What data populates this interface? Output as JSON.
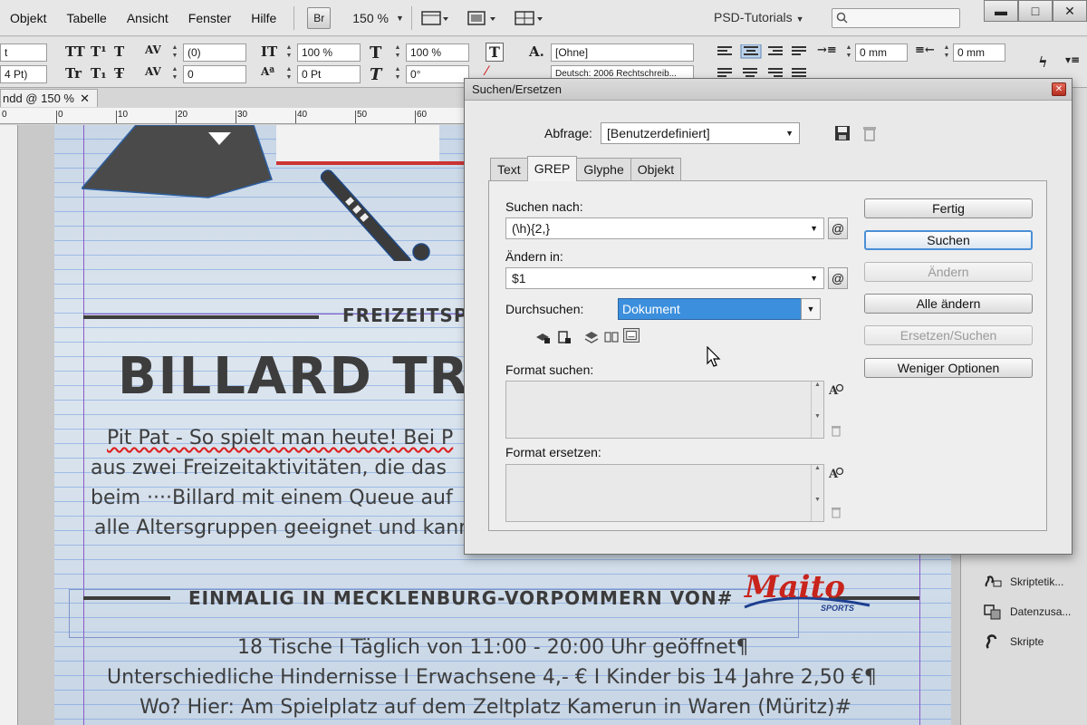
{
  "menubar": {
    "items": [
      "Objekt",
      "Tabelle",
      "Ansicht",
      "Fenster",
      "Hilfe"
    ],
    "bridge_label": "Br",
    "zoom": "150 %",
    "workspace": "PSD-Tutorials"
  },
  "controlpanel": {
    "font_size_a": "t",
    "font_size_b": "4 Pt)",
    "tracking": "(0)",
    "kerning": "0",
    "vert_scale": "100 %",
    "horiz_scale": "100 %",
    "baseline": "0 Pt",
    "skew": "0°",
    "char_style": "[Ohne]",
    "language": "Deutsch: 2006 Rechtschreib...",
    "indent_left": "0 mm",
    "indent_right": "0 mm"
  },
  "document": {
    "tab_label": "ndd @ 150 %",
    "ruler_ticks": [
      "0",
      "10",
      "20",
      "30",
      "40",
      "50",
      "60"
    ],
    "heading_sub": "FREIZEITSPA",
    "heading_main": "BILLARD TRIFF",
    "body_lines": [
      "Pit Pat - So spielt man heute! Bei P",
      "aus zwei Freizeitaktivitäten, die das",
      "beim ····Billard mit einem Queue auf",
      "alle Altersgruppen geeignet und kann"
    ],
    "region_heading": "EINMALIG IN MECKLENBURG-VORPOMMERN VON#",
    "logo_text": "Maito",
    "logo_sub": "SPORTS",
    "info_lines": [
      "18 Tische I Täglich  von 11:00  - 20:00 Uhr geöffnet¶",
      "Unterschiedliche Hindernisse I Erwachsene 4,- € I Kinder bis 14 Jahre 2,50 €¶",
      "Wo? Hier: Am Spielplatz auf dem Zeltplatz   Kamerun in Waren (Müritz)#"
    ]
  },
  "right_panel": {
    "items": [
      "Skriptetik...",
      "Datenzusa...",
      "Skripte"
    ]
  },
  "dialog": {
    "title": "Suchen/Ersetzen",
    "query_label": "Abfrage:",
    "query_value": "[Benutzerdefiniert]",
    "tabs": [
      "Text",
      "GREP",
      "Glyphe",
      "Objekt"
    ],
    "active_tab": "GREP",
    "search_label": "Suchen nach:",
    "search_value": "(\\h){2,}",
    "replace_label": "Ändern in:",
    "replace_value": "$1",
    "scope_label": "Durchsuchen:",
    "scope_value": "Dokument",
    "format_search_label": "Format suchen:",
    "format_replace_label": "Format ersetzen:",
    "at_symbol": "@",
    "buttons": {
      "done": "Fertig",
      "search": "Suchen",
      "change": "Ändern",
      "change_all": "Alle ändern",
      "change_find": "Ersetzen/Suchen",
      "fewer_options": "Weniger Optionen"
    }
  },
  "colors": {
    "accent": "#3c8fdc",
    "margin_guide": "#8a5ac8",
    "baseline_grid": "#5a8cdc",
    "logo_red": "#c8241c"
  }
}
